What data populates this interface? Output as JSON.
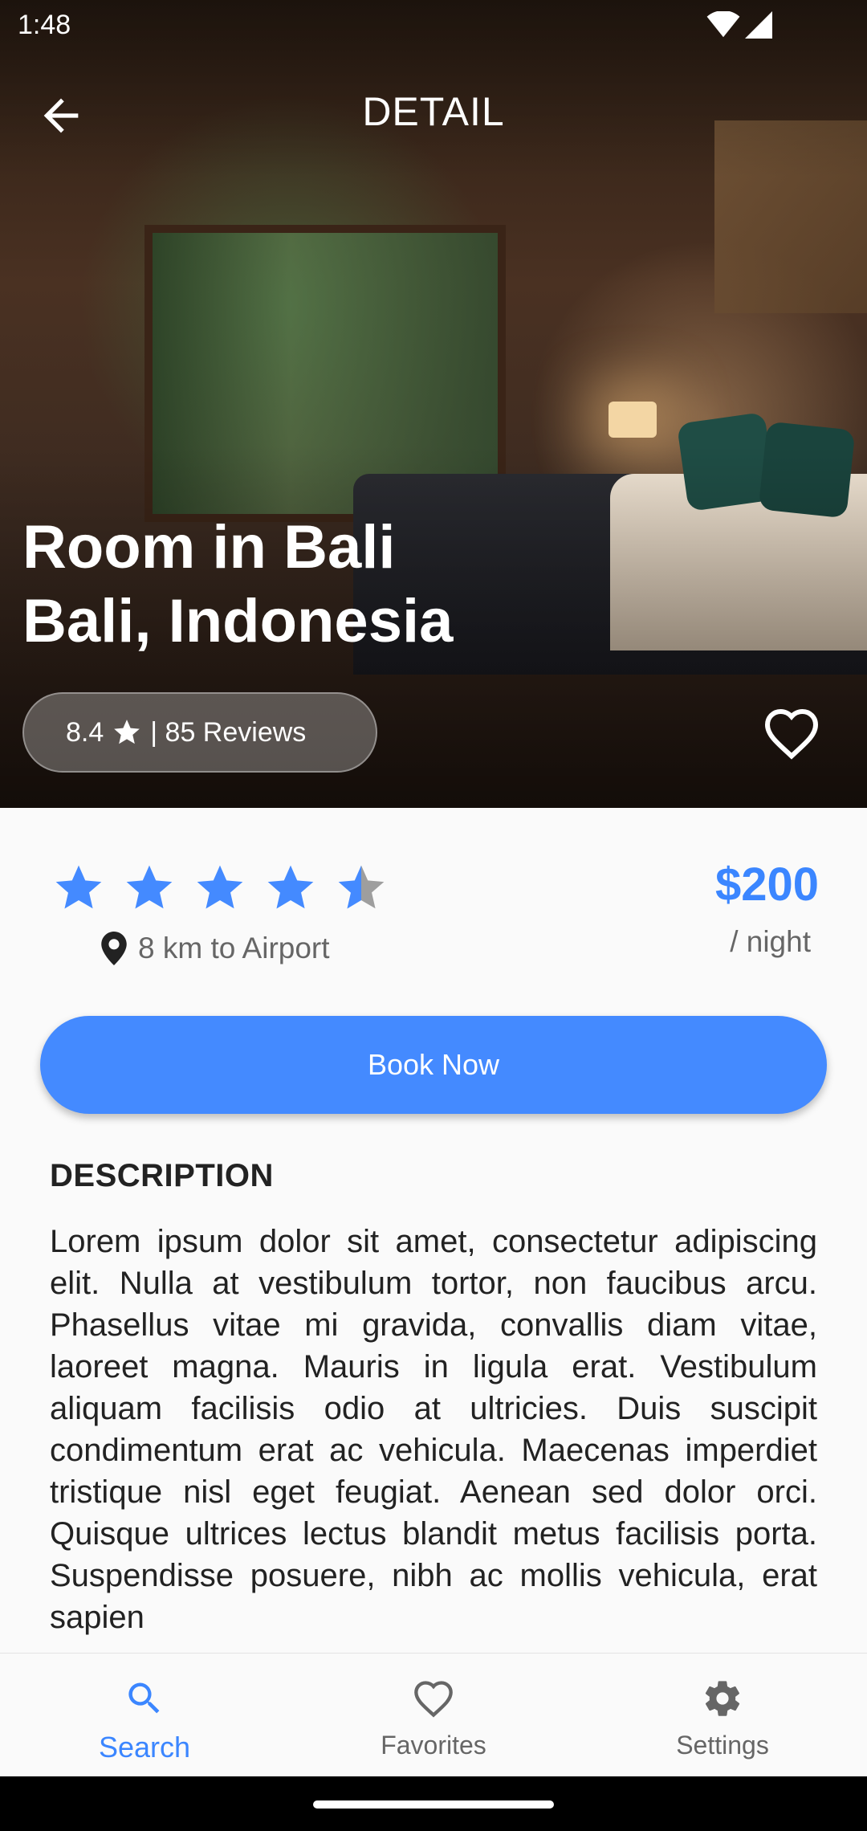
{
  "status_bar": {
    "time": "1:48"
  },
  "app_bar": {
    "title": "DETAIL"
  },
  "hero": {
    "title_line1": "Room in Bali",
    "title_line2": "Bali, Indonesia",
    "rating_value": "8.4",
    "reviews_text": "| 85 Reviews"
  },
  "listing": {
    "star_rating": 4.5,
    "distance": "8 km to Airport",
    "price": "$200",
    "price_unit": "/ night",
    "book_label": "Book Now"
  },
  "description": {
    "heading": "DESCRIPTION",
    "text": "Lorem ipsum dolor sit amet, consectetur adipiscing elit. Nulla at vestibulum tortor, non faucibus arcu. Phasellus vitae mi gravida, convallis diam vitae, laoreet magna. Mauris in ligula erat. Vestibulum aliquam facilisis odio at ultricies. Duis suscipit condimentum erat ac vehicula. Maecenas imperdiet tristique nisl eget feugiat. Aenean sed dolor orci. Quisque ultrices lectus blandit metus facilisis porta. Suspendisse posuere, nibh ac mollis vehicula, erat sapien"
  },
  "bottom_nav": {
    "items": [
      {
        "label": "Search",
        "icon": "search-icon"
      },
      {
        "label": "Favorites",
        "icon": "heart-outline-icon"
      },
      {
        "label": "Settings",
        "icon": "gear-icon"
      }
    ],
    "active": "Search"
  },
  "colors": {
    "accent": "#448aff",
    "accent_text": "#3b86ff",
    "muted": "#666666"
  }
}
